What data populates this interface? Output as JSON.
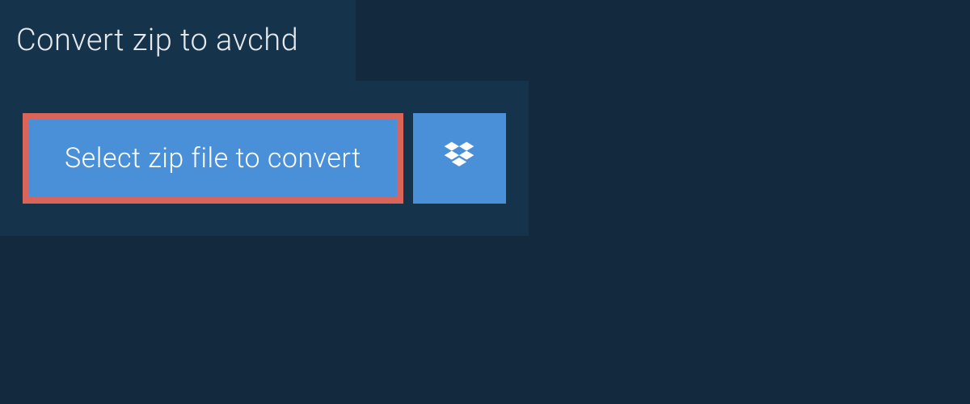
{
  "header": {
    "title": "Convert zip to avchd"
  },
  "actions": {
    "select_file_label": "Select zip file to convert"
  },
  "colors": {
    "background": "#12293e",
    "panel": "#16334c",
    "button": "#4a90d9",
    "highlight_border": "#d96459",
    "text_light": "#e6e9ec"
  }
}
